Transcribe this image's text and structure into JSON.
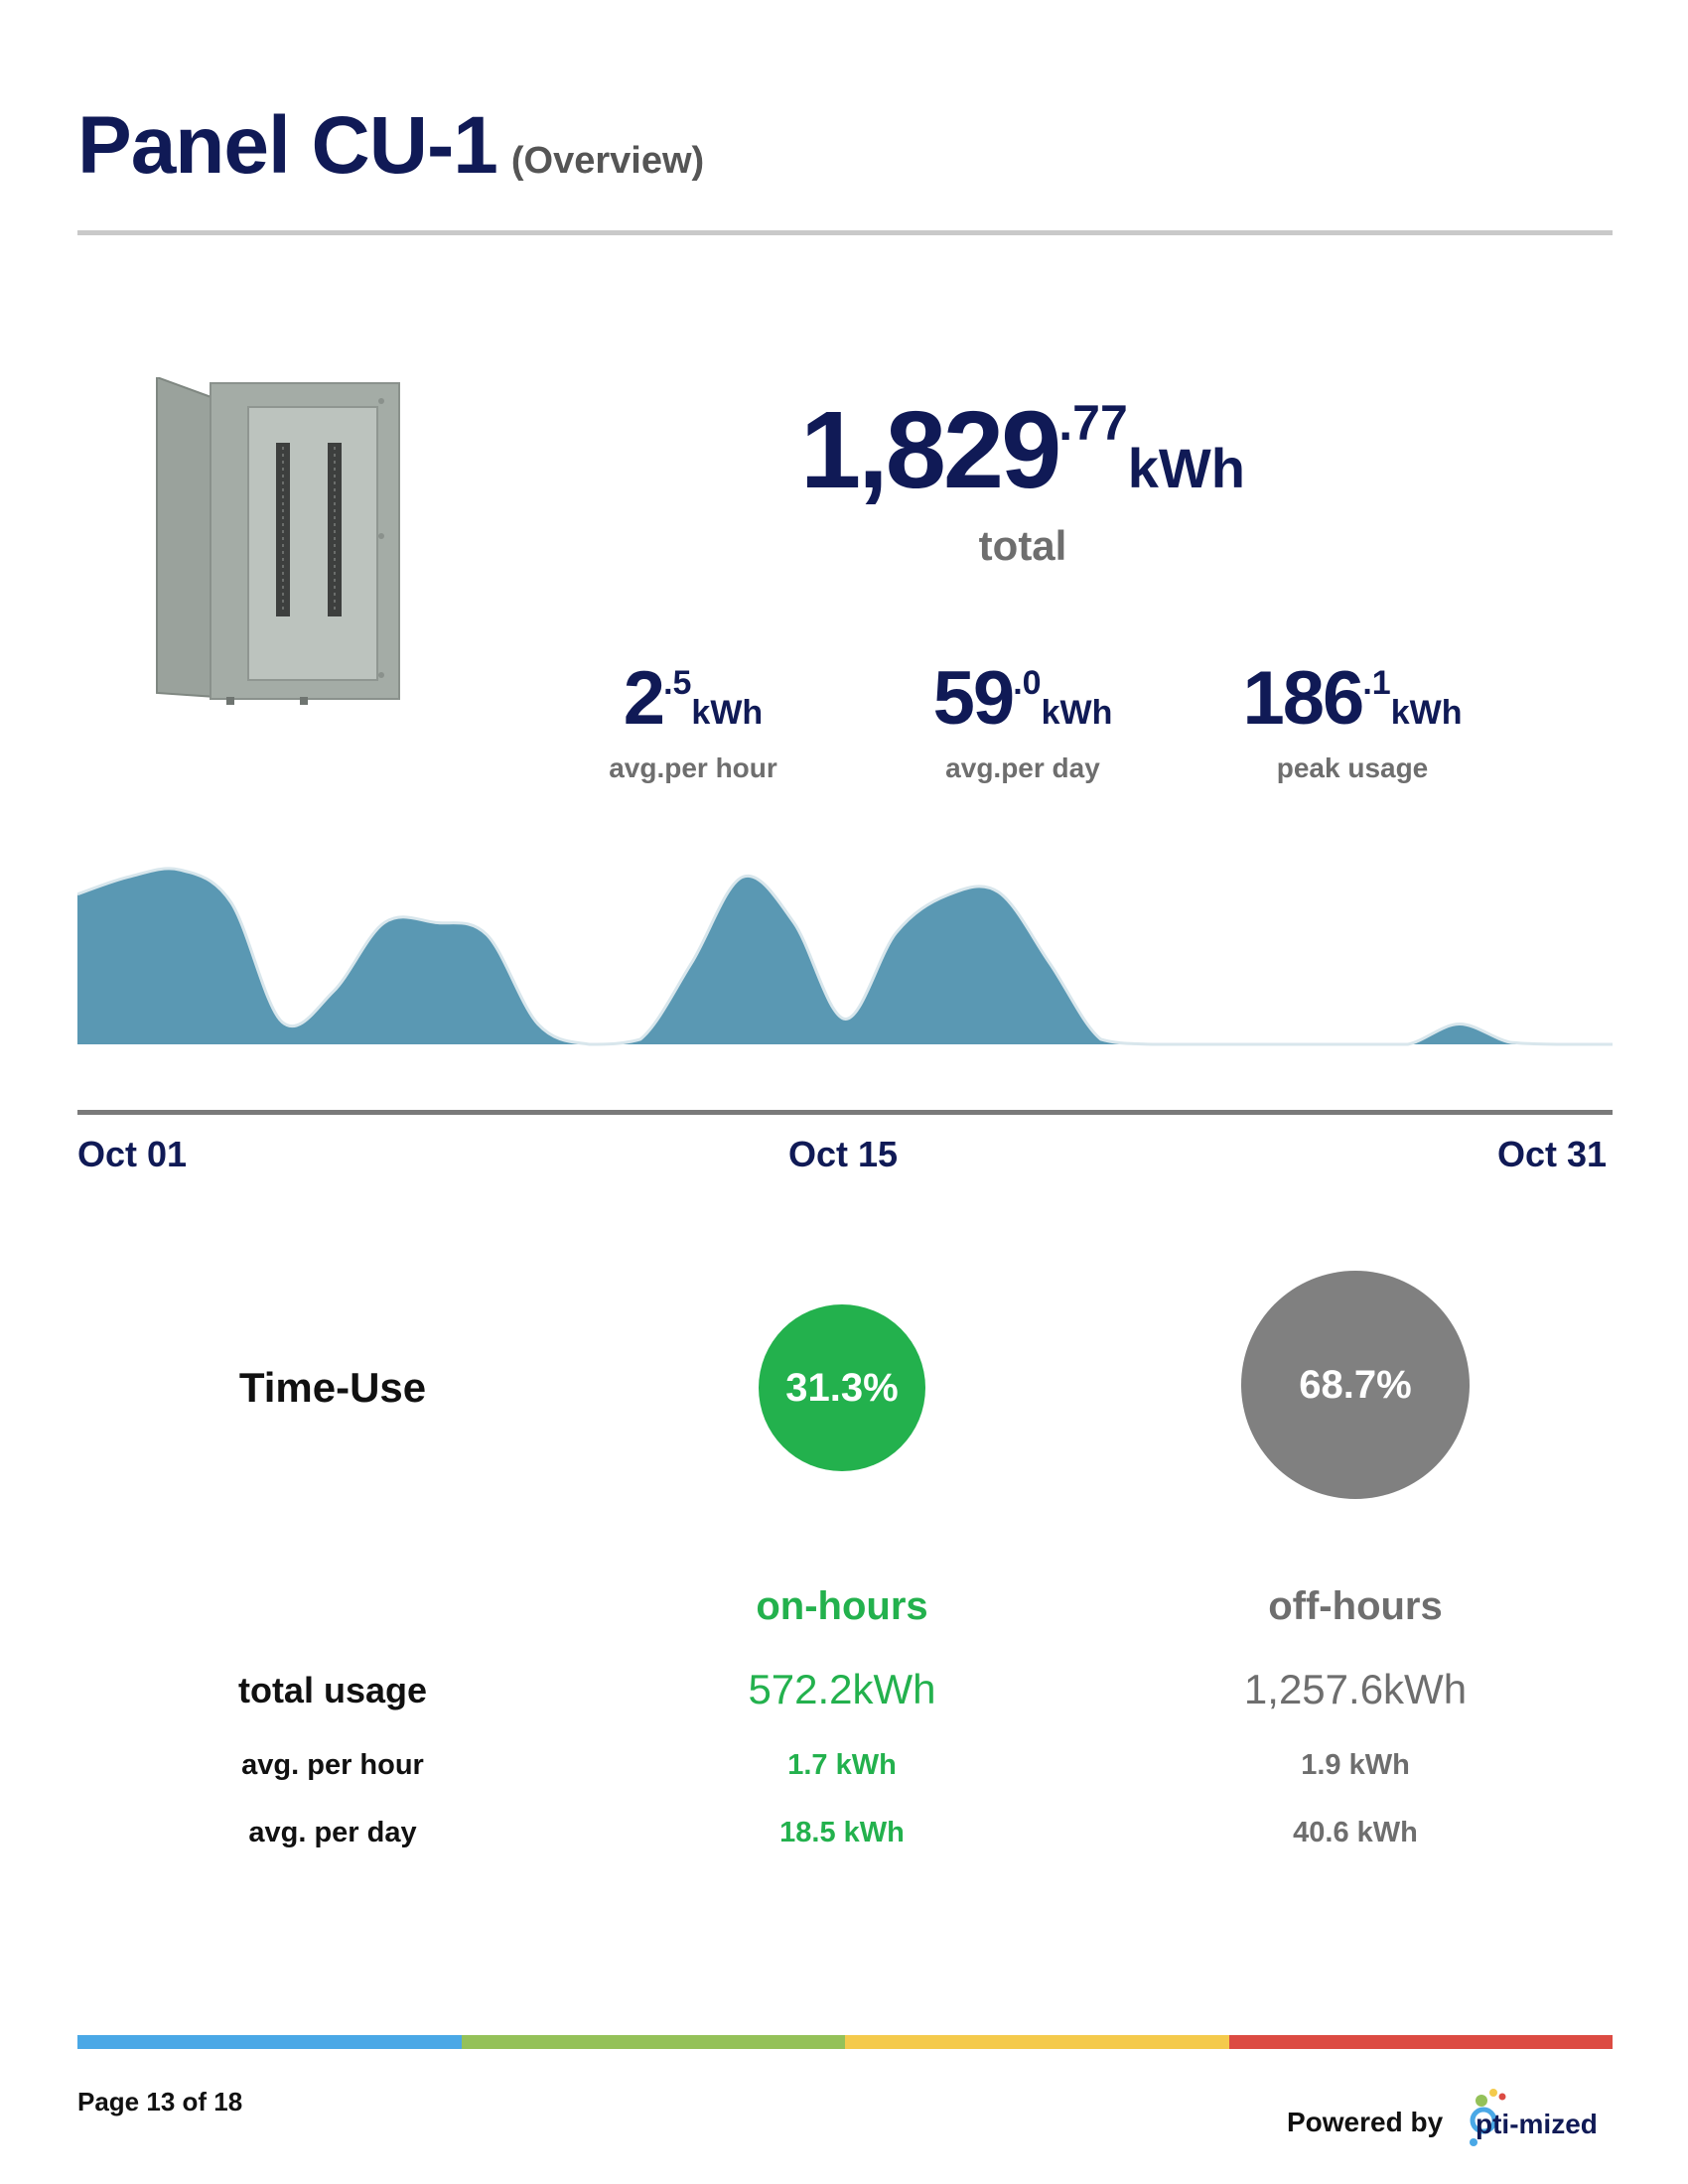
{
  "header": {
    "title": "Panel CU-1",
    "subtitle": "(Overview)"
  },
  "panel_image": {
    "icon": "electrical-panel-icon"
  },
  "total": {
    "whole": "1,829",
    "decimal": ".77",
    "unit": "kWh",
    "label": "total"
  },
  "stats": [
    {
      "whole": "2",
      "decimal": ".5",
      "unit": "kWh",
      "label": "avg.per hour"
    },
    {
      "whole": "59",
      "decimal": ".0",
      "unit": "kWh",
      "label": "avg.per day"
    },
    {
      "whole": "186",
      "decimal": ".1",
      "unit": "kWh",
      "label": "peak usage"
    }
  ],
  "chart_data": {
    "type": "area",
    "x": [
      "Oct 01",
      "Oct 02",
      "Oct 03",
      "Oct 04",
      "Oct 05",
      "Oct 06",
      "Oct 07",
      "Oct 08",
      "Oct 09",
      "Oct 10",
      "Oct 11",
      "Oct 12",
      "Oct 13",
      "Oct 14",
      "Oct 15",
      "Oct 16",
      "Oct 17",
      "Oct 18",
      "Oct 19",
      "Oct 20",
      "Oct 21",
      "Oct 22",
      "Oct 23",
      "Oct 24",
      "Oct 25",
      "Oct 26",
      "Oct 27",
      "Oct 28",
      "Oct 29",
      "Oct 30",
      "Oct 31"
    ],
    "values": [
      148,
      165,
      172,
      140,
      22,
      52,
      120,
      120,
      108,
      20,
      0,
      5,
      80,
      165,
      120,
      25,
      110,
      147,
      150,
      80,
      5,
      0,
      0,
      0,
      0,
      0,
      0,
      20,
      2,
      0,
      0
    ],
    "color": "#5a98b3",
    "xticks": [
      "Oct 01",
      "Oct 15",
      "Oct 31"
    ]
  },
  "time_use": {
    "label": "Time-Use",
    "on": {
      "percent": "31.3%",
      "title": "on-hours",
      "total": "572.2kWh",
      "per_hour": "1.7 kWh",
      "per_day": "18.5 kWh",
      "color": "#23b14d"
    },
    "off": {
      "percent": "68.7%",
      "title": "off-hours",
      "total": "1,257.6kWh",
      "per_hour": "1.9 kWh",
      "per_day": "40.6 kWh",
      "color": "#808080"
    },
    "row_labels": {
      "total": "total usage",
      "per_hour": "avg. per hour",
      "per_day": "avg. per day"
    }
  },
  "footer": {
    "page": "Page 13 of 18",
    "powered_by": "Powered by",
    "logo_text": "pti-mized",
    "bar_colors": [
      "#4aa8e6",
      "#94c159",
      "#f4ca4c",
      "#dc4b43"
    ]
  }
}
